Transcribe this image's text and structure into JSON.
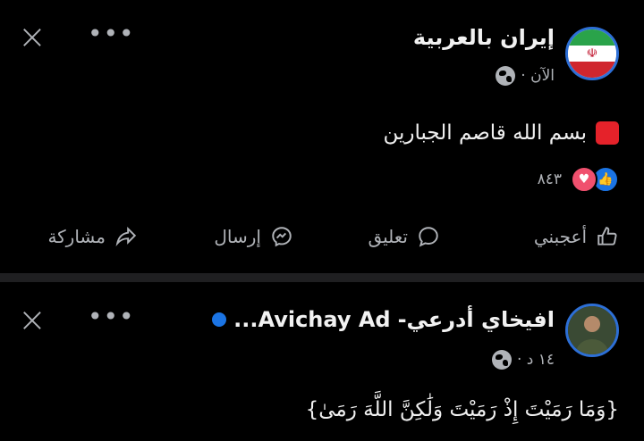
{
  "post1": {
    "page_name": "إيران بالعربية",
    "time": "الآن ·",
    "text": "بسم الله قاصم الجبارين",
    "reactions_count": "٨٤٣",
    "flag_emblem": "☫"
  },
  "actions": {
    "like": "أعجبني",
    "comment": "تعليق",
    "send": "إرسال",
    "share": "مشاركة"
  },
  "post2": {
    "name_ar": "افيخاي أدرعي-",
    "name_en": "...Avichay Ad",
    "time": "١٤ د ·",
    "text": "{وَمَا رَمَيْتَ إِذْ رَمَيْتَ وَلَٰكِنَّ اللَّهَ رَمَىٰ}"
  },
  "icons": {
    "close": "×",
    "more": "•••",
    "like": "👍",
    "love": "♥"
  }
}
